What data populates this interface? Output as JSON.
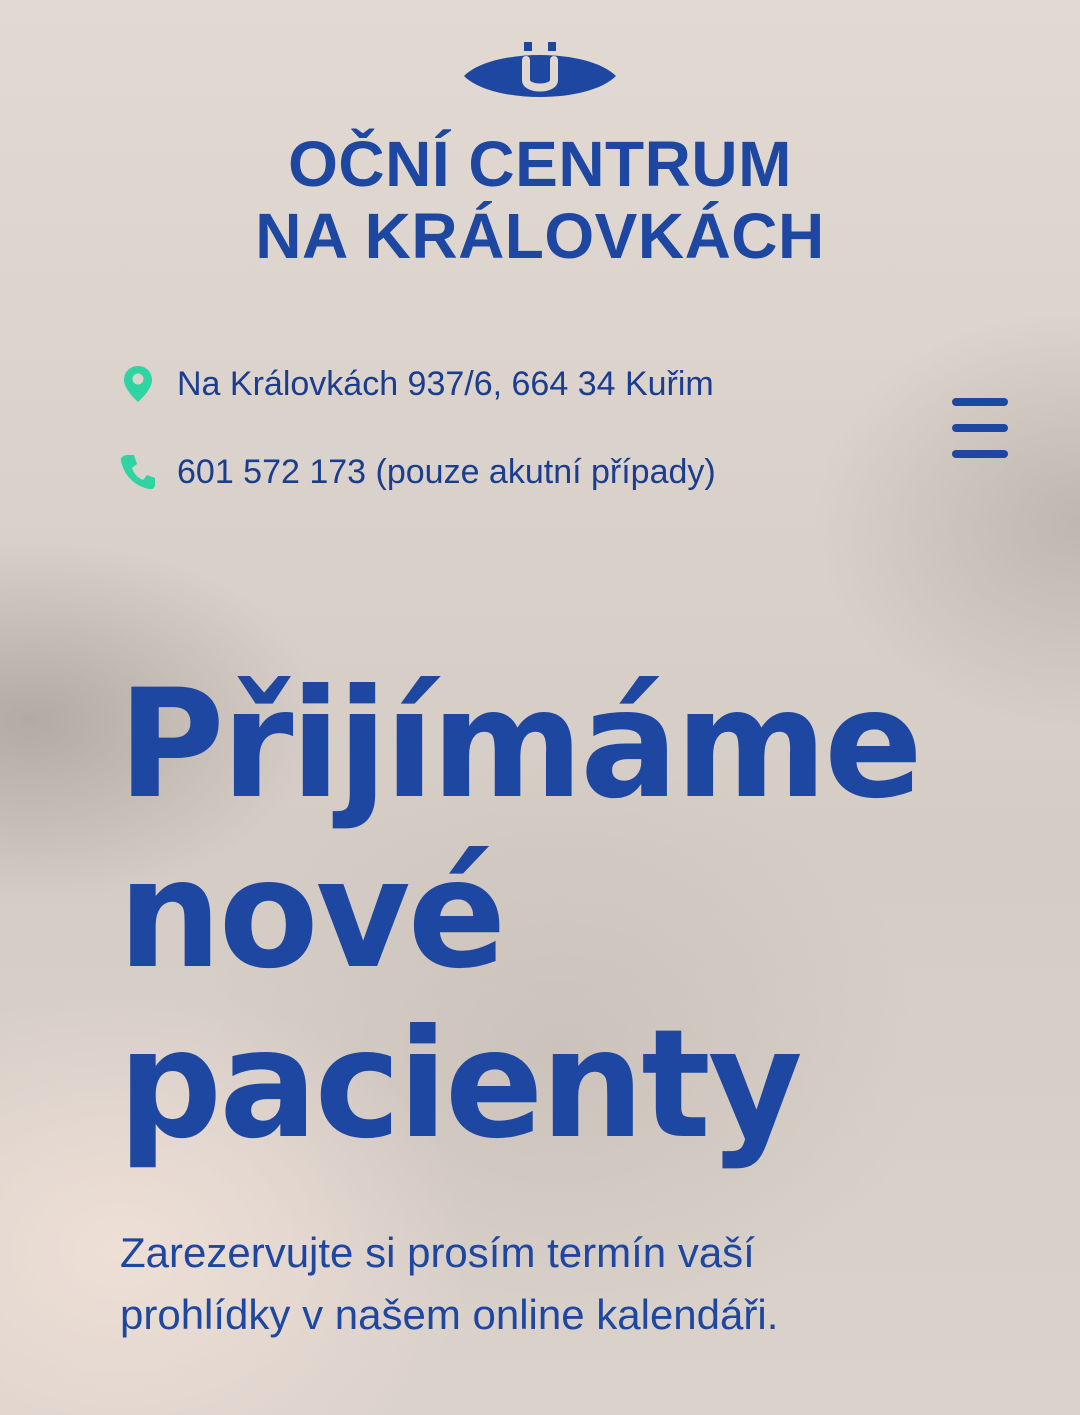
{
  "header": {
    "brand_line_1": "OČNÍ CENTRUM",
    "brand_line_2": "NA KRÁLOVKÁCH",
    "logo_icon": "eye-logo-icon"
  },
  "contacts": {
    "address": "Na Královkách 937/6, 664 34 Kuřim",
    "address_icon": "map-pin-icon",
    "phone": "601 572 173 (pouze akutní případy)",
    "phone_icon": "phone-icon"
  },
  "menu": {
    "icon": "hamburger-menu-icon"
  },
  "hero": {
    "line_1": "Přijímáme",
    "line_2": "nové",
    "line_3": "pacienty"
  },
  "subtitle": {
    "line_1": "Zarezervujte si prosím termín vaší",
    "line_2": "prohlídky v našem online kalendáři."
  },
  "colors": {
    "primary": "#1d47a0",
    "accent": "#2fd4a2",
    "text": "#1b3d8f",
    "background": "#dcd3cd"
  }
}
